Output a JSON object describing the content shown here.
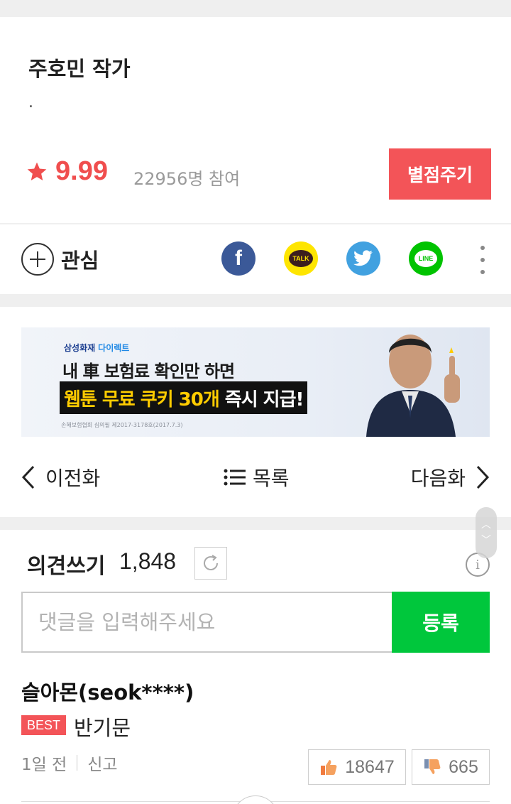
{
  "author": {
    "name": "주호민 작가",
    "description": ".",
    "rating": "9.99",
    "participants": "22956명 참여",
    "rate_button": "별점주기"
  },
  "share": {
    "favorite_label": "관심",
    "icons": [
      "facebook-icon",
      "kakaotalk-icon",
      "twitter-icon",
      "line-icon",
      "more-icon"
    ],
    "kakao_text": "TALK",
    "line_text": "LINE",
    "facebook_text": "f"
  },
  "ad": {
    "brand": "삼성화재",
    "brand_accent": "다이렉트",
    "line1": "내 車 보험료 확인만 하면",
    "line2_highlight": "웹툰 무료 쿠키 30개",
    "line2_rest": "즉시 지급!",
    "fine_print": "손해보험협회 심의필 제2017-3178호(2017.7.3)"
  },
  "nav": {
    "prev": "이전화",
    "list": "목록",
    "next": "다음화"
  },
  "comments": {
    "title": "의견쓰기",
    "count": "1,848",
    "placeholder": "댓글을 입력해주세요",
    "submit": "등록",
    "items": [
      {
        "author": "슬아몬(seok****)",
        "badge": "BEST",
        "text": "반기문",
        "time": "1일 전",
        "report": "신고",
        "likes": "18647",
        "dislikes": "665"
      }
    ]
  },
  "colors": {
    "accent_red": "#f35458",
    "rating_red": "#f04e4e",
    "submit_green": "#00c73c",
    "facebook": "#3b5998",
    "kakao": "#fee500",
    "twitter": "#41a1e0",
    "line": "#00c300"
  }
}
